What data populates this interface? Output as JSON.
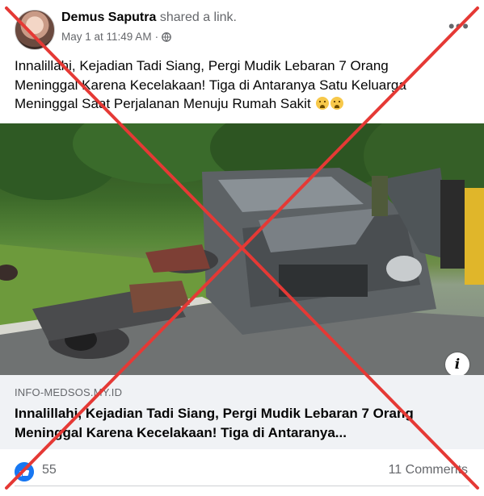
{
  "post": {
    "author": "Demus Saputra",
    "action": "shared a link.",
    "timestamp": "May 1 at 11:49 AM",
    "dot": "·",
    "more_label": "•••",
    "caption": "Innalillahi, Kejadian Tadi Siang, Pergi Mudik Lebaran 7 Orang Meninggal Karena Kecelakaan! Tiga di Antaranya Satu Keluarga Meninggal Saat Perjalanan Menuju Rumah Sakit"
  },
  "link": {
    "domain": "INFO-MEDSOS.MY.ID",
    "title": "Innalillahi, Kejadian Tadi Siang, Pergi Mudik Lebaran 7 Orang Meninggal Karena Kecelakaan! Tiga di Antaranya..."
  },
  "photo": {
    "info_label": "i"
  },
  "reactions": {
    "like_count": "55",
    "comments": "11 Comments"
  },
  "colors": {
    "overlay_x": "#e53935",
    "like_blue": "#1877f2",
    "secondary_text": "#65676b"
  },
  "icons": [
    "globe-icon",
    "more-icon",
    "info-icon",
    "like-reaction-icon",
    "crying-face-emoji"
  ]
}
